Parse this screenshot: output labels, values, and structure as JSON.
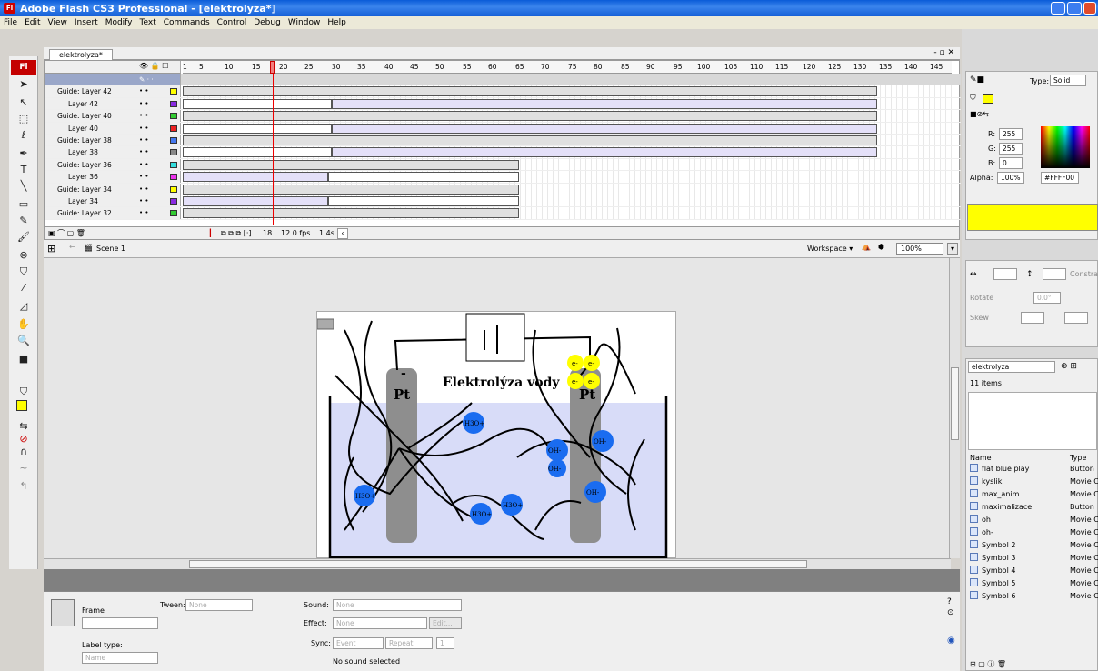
{
  "window": {
    "title": "Adobe Flash CS3 Professional - [elektrolyza*]"
  },
  "menu": [
    "File",
    "Edit",
    "View",
    "Insert",
    "Modify",
    "Text",
    "Commands",
    "Control",
    "Debug",
    "Window",
    "Help"
  ],
  "document_tab": "elektrolyza*",
  "timeline": {
    "ruler": [
      "1",
      "5",
      "10",
      "15",
      "20",
      "25",
      "30",
      "35",
      "40",
      "45",
      "50",
      "55",
      "60",
      "65",
      "70",
      "75",
      "80",
      "85",
      "90",
      "95",
      "100",
      "105",
      "110",
      "115",
      "120",
      "125",
      "130",
      "135",
      "140",
      "145"
    ],
    "layers": [
      {
        "name": "Guide: Layer 42",
        "type": "guide",
        "color": "#ffff00"
      },
      {
        "name": "Layer 42",
        "type": "layer",
        "color": "#8a2be2"
      },
      {
        "name": "Guide: Layer 40",
        "type": "guide",
        "color": "#33cc33"
      },
      {
        "name": "Layer 40",
        "type": "layer",
        "color": "#ee2222"
      },
      {
        "name": "Guide: Layer 38",
        "type": "guide",
        "color": "#4477ee"
      },
      {
        "name": "Layer 38",
        "type": "layer",
        "color": "#888888"
      },
      {
        "name": "Guide: Layer 36",
        "type": "guide",
        "color": "#33dddd"
      },
      {
        "name": "Layer 36",
        "type": "layer",
        "color": "#ee33ee"
      },
      {
        "name": "Guide: Layer 34",
        "type": "guide",
        "color": "#ffff00"
      },
      {
        "name": "Layer 34",
        "type": "layer",
        "color": "#8a2be2"
      },
      {
        "name": "Guide: Layer 32",
        "type": "guide",
        "color": "#33cc33"
      }
    ],
    "status": {
      "frame": "18",
      "fps": "12.0 fps",
      "time": "1.4s"
    }
  },
  "scene": {
    "name": "Scene 1",
    "workspace": "Workspace ▾",
    "zoom": "100%"
  },
  "stage": {
    "title": "Elektrolýza vody",
    "electrode_left": "Pt",
    "electrode_right": "Pt",
    "minus": "-",
    "ions": [
      "H3O+",
      "OH-",
      "OH-",
      "OH-",
      "H3O+",
      "H3O+",
      "H3O+",
      "OH-",
      "OH-"
    ],
    "electron": "e-"
  },
  "properties": {
    "frame_label": "Frame",
    "tween_label": "Tween:",
    "tween_value": "None",
    "sound_label": "Sound:",
    "sound_value": "None",
    "effect_label": "Effect:",
    "effect_value": "None",
    "edit_label": "Edit...",
    "sync_label": "Sync:",
    "sync_value": "Event",
    "repeat_value": "Repeat",
    "repeat_count": "1",
    "label_type_label": "Label type:",
    "label_type_value": "Name",
    "no_sound": "No sound selected"
  },
  "color": {
    "type_label": "Type:",
    "type_value": "Solid",
    "r_label": "R:",
    "r": "255",
    "g_label": "G:",
    "g": "255",
    "b_label": "B:",
    "b": "0",
    "alpha_label": "Alpha:",
    "alpha": "100%",
    "hex": "#FFFF00"
  },
  "transform": {
    "constrain": "Constrain",
    "rotate": "Rotate",
    "rotate_value": "0.0°",
    "skew": "Skew"
  },
  "library": {
    "name": "elektrolyza",
    "count": "11 items",
    "col_name": "Name",
    "col_type": "Type",
    "items": [
      {
        "name": "flat blue play",
        "type": "Button"
      },
      {
        "name": "kyslik",
        "type": "Movie C"
      },
      {
        "name": "max_anim",
        "type": "Movie C"
      },
      {
        "name": "maximalizace",
        "type": "Button"
      },
      {
        "name": "oh",
        "type": "Movie C"
      },
      {
        "name": "oh-",
        "type": "Movie C"
      },
      {
        "name": "Symbol 2",
        "type": "Movie C"
      },
      {
        "name": "Symbol 3",
        "type": "Movie C"
      },
      {
        "name": "Symbol 4",
        "type": "Movie C"
      },
      {
        "name": "Symbol 5",
        "type": "Movie C"
      },
      {
        "name": "Symbol 6",
        "type": "Movie C"
      }
    ]
  }
}
